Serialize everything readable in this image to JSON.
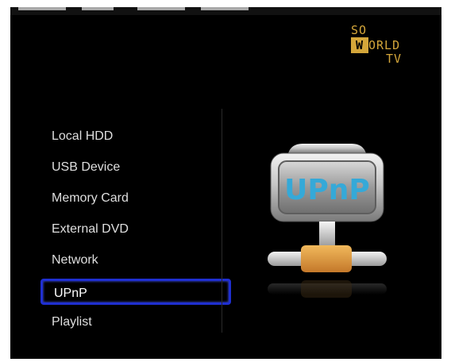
{
  "brand": {
    "line1": "SO",
    "line2_box": "W",
    "line2_rest": "ORLD",
    "line3": "TV",
    "color": "#d4a63a"
  },
  "menu": {
    "items": [
      {
        "label": "Local HDD",
        "selected": false
      },
      {
        "label": "USB Device",
        "selected": false
      },
      {
        "label": "Memory Card",
        "selected": false
      },
      {
        "label": "External DVD",
        "selected": false
      },
      {
        "label": "Network",
        "selected": false
      },
      {
        "label": "UPnP",
        "selected": true
      },
      {
        "label": "Playlist",
        "selected": false
      }
    ],
    "selection_color": "#1f2fd1"
  },
  "preview": {
    "icon": "upnp-network-icon",
    "label": "UPnP",
    "label_color": "#35a9d8",
    "connector_color": "#e0a04a"
  }
}
